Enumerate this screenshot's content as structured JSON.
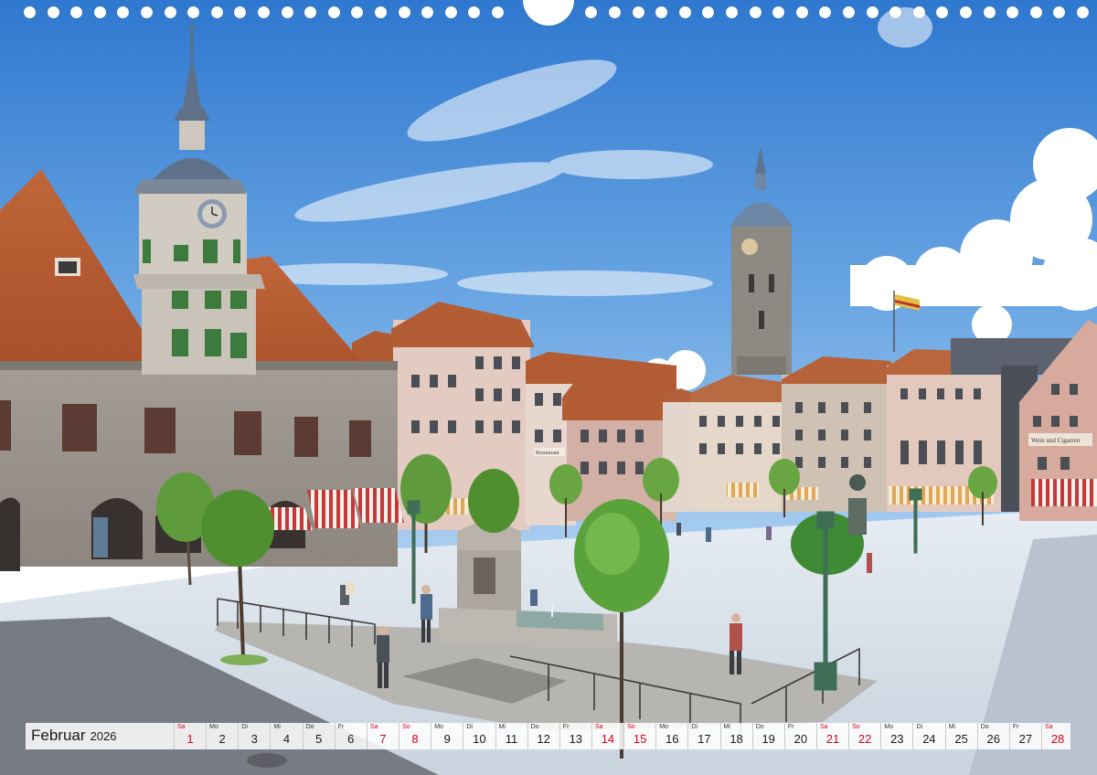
{
  "calendar": {
    "month": "Februar",
    "year": "2026",
    "holiday_color": "#d8001b",
    "days": [
      {
        "wd": "Sa",
        "num": "1",
        "holiday": true
      },
      {
        "wd": "Mo",
        "num": "2",
        "holiday": false
      },
      {
        "wd": "Di",
        "num": "3",
        "holiday": false
      },
      {
        "wd": "Mi",
        "num": "4",
        "holiday": false
      },
      {
        "wd": "Do",
        "num": "5",
        "holiday": false
      },
      {
        "wd": "Fr",
        "num": "6",
        "holiday": false
      },
      {
        "wd": "Sa",
        "num": "7",
        "holiday": true
      },
      {
        "wd": "So",
        "num": "8",
        "holiday": true
      },
      {
        "wd": "Mo",
        "num": "9",
        "holiday": false
      },
      {
        "wd": "Di",
        "num": "10",
        "holiday": false
      },
      {
        "wd": "Mi",
        "num": "11",
        "holiday": false
      },
      {
        "wd": "Do",
        "num": "12",
        "holiday": false
      },
      {
        "wd": "Fr",
        "num": "13",
        "holiday": false
      },
      {
        "wd": "Sa",
        "num": "14",
        "holiday": true
      },
      {
        "wd": "So",
        "num": "15",
        "holiday": true
      },
      {
        "wd": "Mo",
        "num": "16",
        "holiday": false
      },
      {
        "wd": "Di",
        "num": "17",
        "holiday": false
      },
      {
        "wd": "Mi",
        "num": "18",
        "holiday": false
      },
      {
        "wd": "Do",
        "num": "19",
        "holiday": false
      },
      {
        "wd": "Fr",
        "num": "20",
        "holiday": false
      },
      {
        "wd": "Sa",
        "num": "21",
        "holiday": true
      },
      {
        "wd": "So",
        "num": "22",
        "holiday": true
      },
      {
        "wd": "Mo",
        "num": "23",
        "holiday": false
      },
      {
        "wd": "Di",
        "num": "24",
        "holiday": false
      },
      {
        "wd": "Mi",
        "num": "25",
        "holiday": false
      },
      {
        "wd": "Do",
        "num": "26",
        "holiday": false
      },
      {
        "wd": "Fr",
        "num": "27",
        "holiday": false
      },
      {
        "wd": "Sa",
        "num": "28",
        "holiday": true
      }
    ]
  },
  "photo": {
    "shop_signs": [
      "Restaurant",
      "Wein und Cigarren"
    ]
  }
}
